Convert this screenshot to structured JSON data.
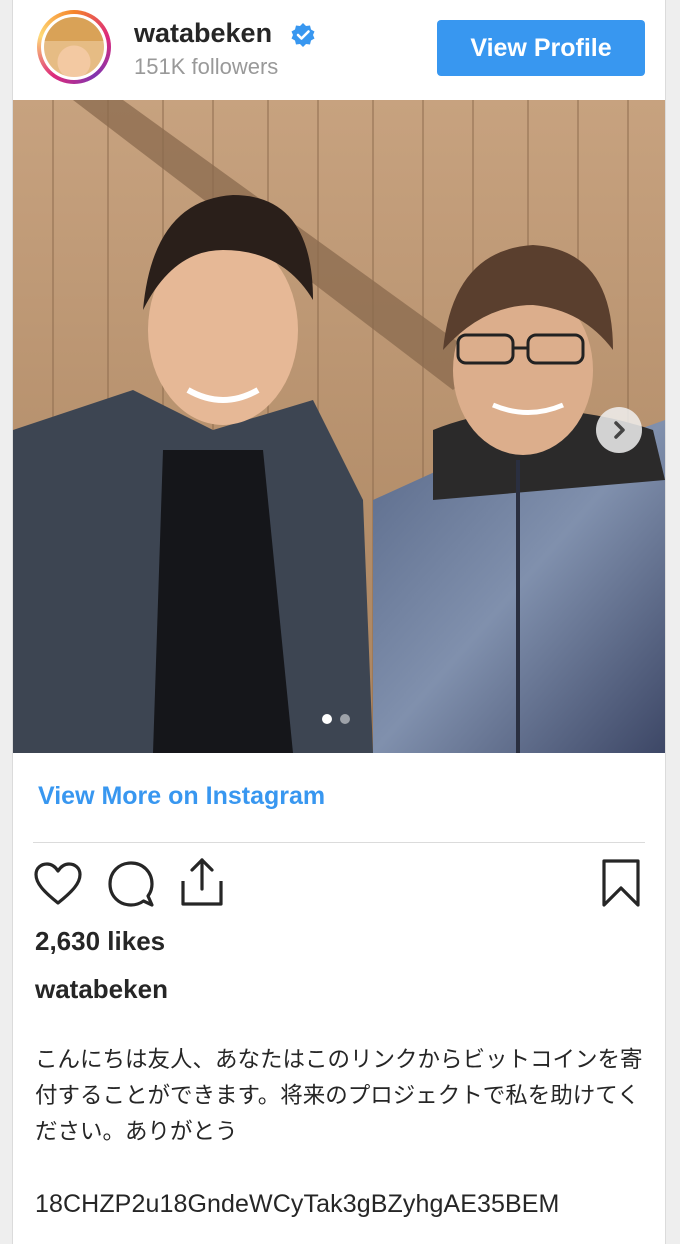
{
  "header": {
    "username": "watabeken",
    "followers": "151K followers",
    "view_profile_label": "View Profile"
  },
  "carousel": {
    "slides": 2,
    "active_slide": 1
  },
  "view_more_label": "View More on Instagram",
  "likes": "2,630 likes",
  "caption": {
    "username": "watabeken",
    "text": "こんにちは友人、あなたはこのリンクからビットコインを寄付することができます。将来のプロジェクトで私を助けてください。ありがとう",
    "code": "18CHZP2u18GndeWCyTak3gBZyhgAE35BEM"
  },
  "colors": {
    "accent": "#3897f0",
    "text": "#262626",
    "muted": "#999999"
  },
  "icons": [
    "verified-badge-icon",
    "chevron-right-icon",
    "heart-icon",
    "comment-icon",
    "share-icon",
    "bookmark-icon"
  ]
}
